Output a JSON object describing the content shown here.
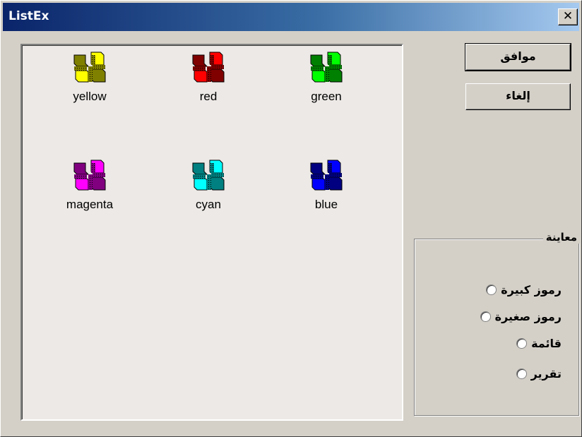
{
  "window": {
    "title": "ListEx",
    "close_glyph": "✕"
  },
  "list": {
    "items": [
      {
        "label": "yellow",
        "icon": "yellow-puzzle-icon",
        "color": "#ffff00",
        "dark": "#808000"
      },
      {
        "label": "red",
        "icon": "red-puzzle-icon",
        "color": "#ff0000",
        "dark": "#800000"
      },
      {
        "label": "green",
        "icon": "green-puzzle-icon",
        "color": "#00ff00",
        "dark": "#008000"
      },
      {
        "label": "magenta",
        "icon": "magenta-puzzle-icon",
        "color": "#ff00ff",
        "dark": "#800080"
      },
      {
        "label": "cyan",
        "icon": "cyan-puzzle-icon",
        "color": "#00ffff",
        "dark": "#008080"
      },
      {
        "label": "blue",
        "icon": "blue-puzzle-icon",
        "color": "#0000ff",
        "dark": "#000080"
      }
    ]
  },
  "buttons": {
    "ok": "موافق",
    "cancel": "إلغاء"
  },
  "preview": {
    "legend": "معاينة",
    "options": [
      {
        "label": "رموز كبيرة"
      },
      {
        "label": "رموز صغيرة"
      },
      {
        "label": "قائمة"
      },
      {
        "label": "تقرير"
      }
    ]
  }
}
